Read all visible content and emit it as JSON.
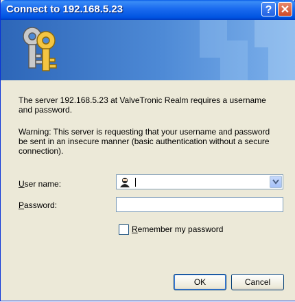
{
  "window": {
    "title": "Connect to 192.168.5.23"
  },
  "titlebar_buttons": {
    "help_glyph": "?",
    "close_glyph": "✕"
  },
  "banner": {
    "icon": "keys-icon"
  },
  "message": {
    "line1": "The server 192.168.5.23 at ValveTronic Realm requires a username and password.",
    "warning": "Warning: This server is requesting that your username and password be sent in an insecure manner (basic authentication without a secure connection)."
  },
  "form": {
    "username_label_mnemonic": "U",
    "username_label_rest": "ser name:",
    "username_value": "",
    "password_label_mnemonic": "P",
    "password_label_rest": "assword:",
    "password_value": "",
    "remember_mnemonic": "R",
    "remember_rest": "emember my password",
    "remember_checked": false
  },
  "buttons": {
    "ok": "OK",
    "cancel": "Cancel"
  },
  "colors": {
    "titlebar": "#0053e1",
    "dialog_bg": "#ece9d8",
    "banner": "#4e8ad6"
  }
}
